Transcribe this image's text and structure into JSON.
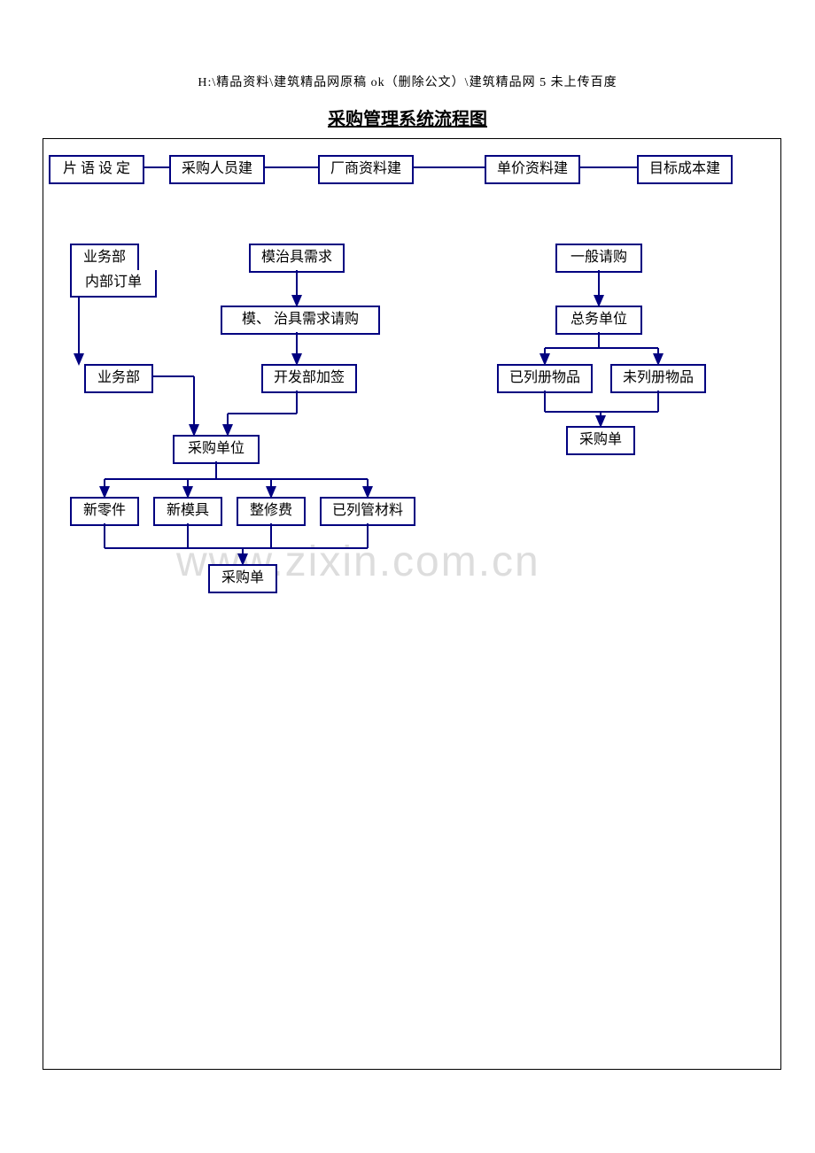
{
  "header": {
    "path": "H:\\精品资料\\建筑精品网原稿 ok（删除公文）\\建筑精品网 5 未上传百度",
    "title": "采购管理系统流程图"
  },
  "watermark": "www.zixin.com.cn",
  "nodes": {
    "t1": "片 语 设 定",
    "t2": "采购人员建",
    "t3": "厂商资料建",
    "t4": "单价资料建",
    "t5": "目标成本建",
    "l1": "业务部",
    "l1b": "内部订单",
    "l2": "业务部",
    "m1": "模治具需求",
    "m2": "模、 治具需求请购",
    "m3": "开发部加签",
    "r1": "一般请购",
    "r2": "总务单位",
    "r3a": "已列册物品",
    "r3b": "未列册物品",
    "r4": "采购单",
    "c1": "采购单位",
    "b1": "新零件",
    "b2": "新模具",
    "b3": "整修费",
    "b4": "已列管材料",
    "b5": "采购单"
  }
}
